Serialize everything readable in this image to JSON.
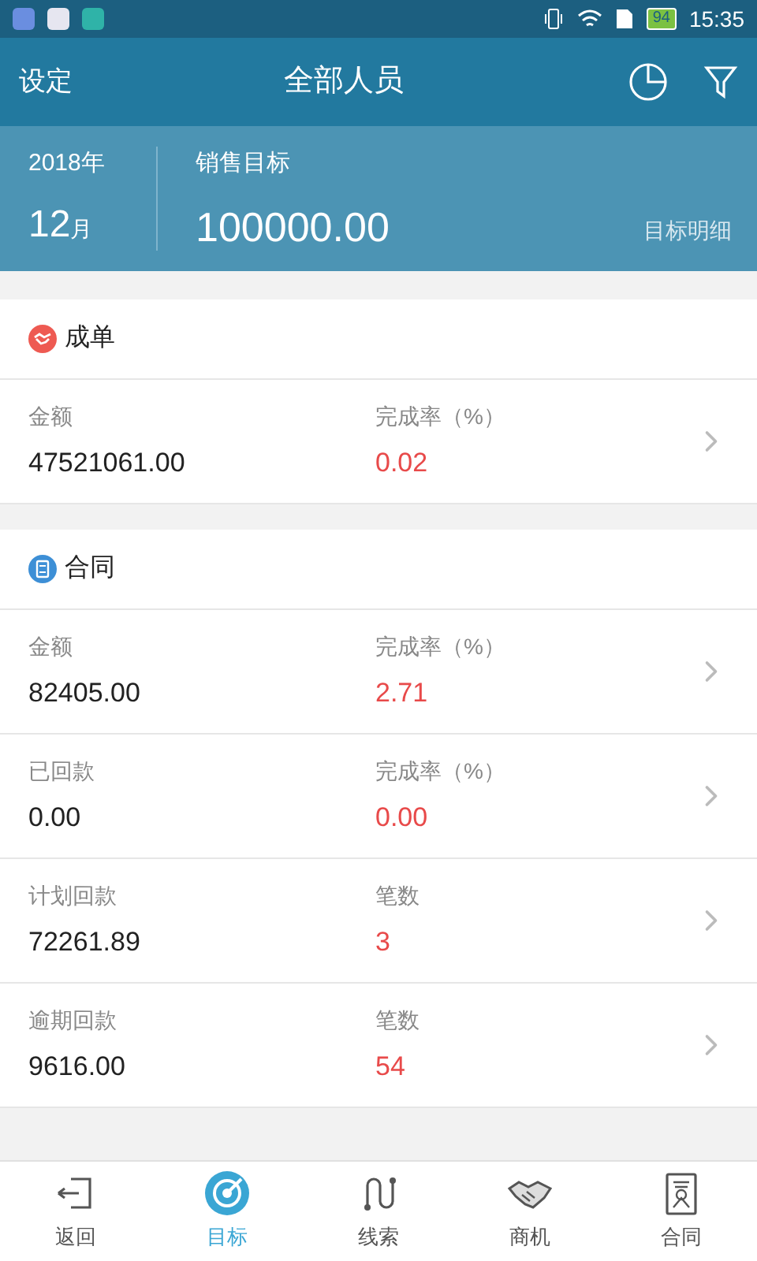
{
  "status_bar": {
    "battery": "94",
    "time": "15:35"
  },
  "header": {
    "left": "设定",
    "title": "全部人员"
  },
  "summary": {
    "year": "2018年",
    "month": "12",
    "month_unit": "月",
    "label": "销售目标",
    "value": "100000.00",
    "link": "目标明细"
  },
  "sections": [
    {
      "title": "成单",
      "rows": [
        {
          "label": "金额",
          "value": "47521061.00",
          "rate_label": "完成率（%）",
          "rate": "0.02"
        }
      ]
    },
    {
      "title": "合同",
      "rows": [
        {
          "label": "金额",
          "value": "82405.00",
          "rate_label": "完成率（%）",
          "rate": "2.71"
        },
        {
          "label": "已回款",
          "value": "0.00",
          "rate_label": "完成率（%）",
          "rate": "0.00"
        },
        {
          "label": "计划回款",
          "value": "72261.89",
          "rate_label": "笔数",
          "rate": "3"
        },
        {
          "label": "逾期回款",
          "value": "9616.00",
          "rate_label": "笔数",
          "rate": "54"
        }
      ]
    }
  ],
  "tabs": [
    {
      "label": "返回",
      "selected": false
    },
    {
      "label": "目标",
      "selected": true
    },
    {
      "label": "线索",
      "selected": false
    },
    {
      "label": "商机",
      "selected": false
    },
    {
      "label": "合同",
      "selected": false
    }
  ]
}
